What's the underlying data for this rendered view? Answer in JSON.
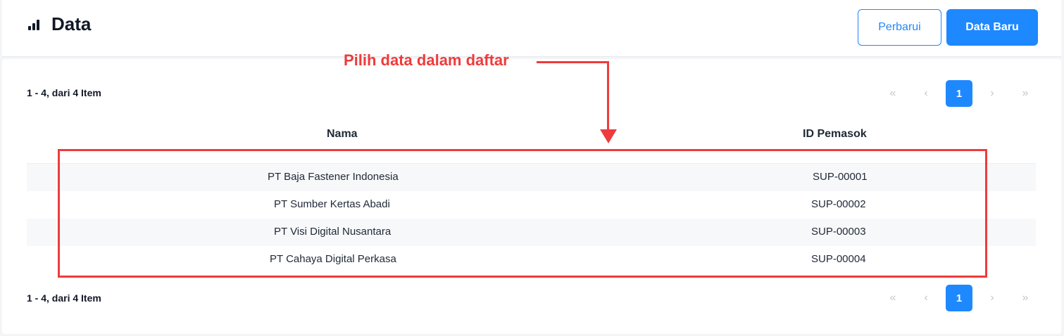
{
  "header": {
    "title": "Data",
    "icon": "bar-chart-icon",
    "refresh_label": "Perbarui",
    "new_label": "Data Baru"
  },
  "summary": {
    "top": "1 - 4, dari 4 Item",
    "bottom": "1 - 4, dari 4 Item"
  },
  "pagination": {
    "first": "«",
    "prev": "‹",
    "current": "1",
    "next": "›",
    "last": "»"
  },
  "table": {
    "columns": [
      "Nama",
      "ID Pemasok"
    ],
    "rows": [
      {
        "name": "PT Baja Fastener Indonesia",
        "id": "SUP-00001"
      },
      {
        "name": "PT Sumber Kertas Abadi",
        "id": "SUP-00002"
      },
      {
        "name": "PT Visi Digital Nusantara",
        "id": "SUP-00003"
      },
      {
        "name": "PT Cahaya Digital Perkasa",
        "id": "SUP-00004"
      }
    ]
  },
  "annotation": {
    "text": "Pilih data dalam daftar",
    "color": "#ef3b3b"
  },
  "colors": {
    "accent": "#1e88ff",
    "row_stripe": "#f7f8fa"
  }
}
